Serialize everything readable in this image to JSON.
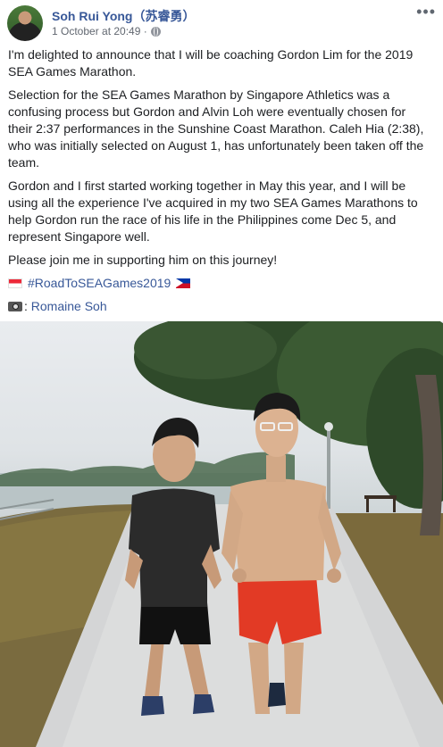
{
  "post": {
    "author": "Soh Rui Yong（苏睿勇）",
    "timestamp": "1 October at 20:49 ·",
    "paragraphs": [
      "I'm delighted to announce that I will be coaching Gordon Lim for the 2019 SEA Games Marathon.",
      "Selection for the SEA Games Marathon by Singapore Athletics was a confusing process but Gordon and Alvin Loh were eventually chosen for their 2:37 performances in the Sunshine Coast Marathon. Caleh Hia (2:38), who was initially selected on August 1, has unfortunately been taken off the team.",
      "Gordon and I first started working together in May this year, and I will be using all the experience I've acquired in my two SEA Games Marathons to help Gordon run the race of his life in the Philippines come Dec 5, and represent Singapore well.",
      "Please join me in supporting him on this journey!"
    ],
    "hashtag": "#RoadToSEAGames2019",
    "photo_credit_prefix": ":",
    "photo_credit_name": "Romaine Soh"
  },
  "icons": {
    "avatar": "profile-photo",
    "privacy": "globe-icon",
    "more": "more-options-icon",
    "flag_left": "singapore-flag-icon",
    "flag_right": "philippines-flag-icon",
    "camera": "camera-icon"
  },
  "colors": {
    "link": "#385898",
    "text": "#1c1e21",
    "meta": "#616770"
  }
}
